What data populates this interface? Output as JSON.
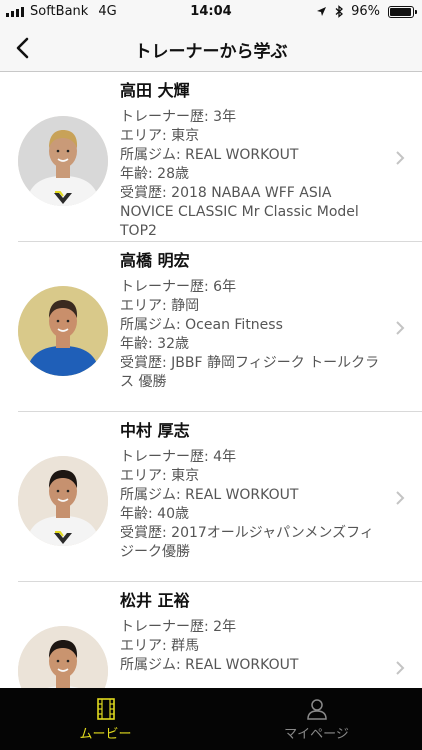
{
  "status_bar": {
    "carrier": "SoftBank",
    "network": "4G",
    "time": "14:04",
    "battery": "96%",
    "battery_level": 0.96
  },
  "nav": {
    "title": "トレーナーから学ぶ"
  },
  "trainers": [
    {
      "name": "高田 大輝",
      "career": "トレーナー歴: 3年",
      "area": "エリア: 東京",
      "gym": "所属ジム: REAL WORKOUT",
      "age": "年齢: 28歳",
      "award": "受賞歴: 2018 NABAA WFF ASIA NOVICE CLASSIC Mr Classic Model TOP2",
      "shirt": "tank-top-logo",
      "skin": "#c99a78",
      "hair": "#c8a258",
      "bg": "#d8d8d8"
    },
    {
      "name": "高橋 明宏",
      "career": "トレーナー歴: 6年",
      "area": "エリア: 静岡",
      "gym": "所属ジム: Ocean Fitness",
      "age": "年齢: 32歳",
      "award": "受賞歴: JBBF 静岡フィジーク トールクラス 優勝",
      "shirt": "blue-shirt",
      "skin": "#c98f6b",
      "hair": "#3a2a20",
      "bg": "#d9c98a"
    },
    {
      "name": "中村 厚志",
      "career": "トレーナー歴: 4年",
      "area": "エリア: 東京",
      "gym": "所属ジム: REAL WORKOUT",
      "age": "年齢: 40歳",
      "award": "受賞歴: 2017オールジャパンメンズフィジーク優勝",
      "shirt": "white-logo-shirt",
      "skin": "#c6916f",
      "hair": "#1d1612",
      "bg": "#ebe3d8"
    },
    {
      "name": "松井 正裕",
      "career": "トレーナー歴: 2年",
      "area": "エリア: 群馬",
      "gym": "所属ジム: REAL WORKOUT",
      "age": "",
      "award": "",
      "shirt": "white-logo-shirt",
      "skin": "#c9946f",
      "hair": "#1d1612",
      "bg": "#ebe3d8"
    }
  ],
  "tabs": [
    {
      "label": "ムービー",
      "icon": "film-icon",
      "active": true
    },
    {
      "label": "マイページ",
      "icon": "person-icon",
      "active": false
    }
  ],
  "colors": {
    "accent": "#e1da1e",
    "tab_bar": "#050505"
  }
}
